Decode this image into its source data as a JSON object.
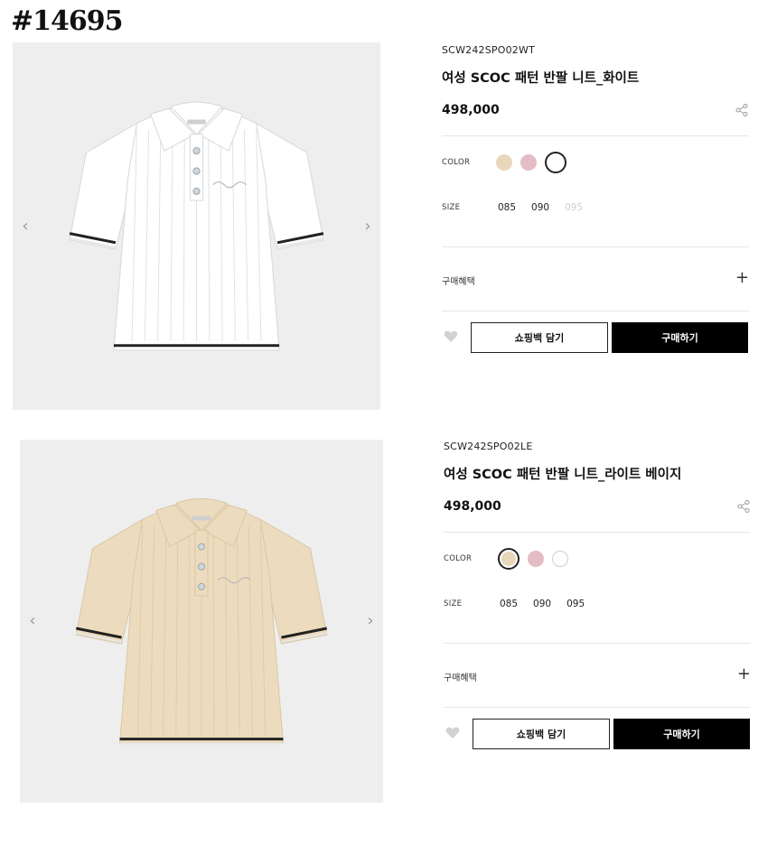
{
  "page_tag": "#14695",
  "products": [
    {
      "code": "SCW242SPO02WT",
      "name": "여성 SCOC 패턴 반팔 니트_화이트",
      "price": "498,000",
      "color_label": "COLOR",
      "colors": [
        {
          "name": "light-beige",
          "hex": "#e8d7bb",
          "selected": false
        },
        {
          "name": "pink",
          "hex": "#e3bcc5",
          "selected": false
        },
        {
          "name": "white",
          "hex": "#ffffff",
          "selected": true
        }
      ],
      "size_label": "SIZE",
      "sizes": [
        {
          "label": "085",
          "available": true
        },
        {
          "label": "090",
          "available": true
        },
        {
          "label": "095",
          "available": false
        }
      ],
      "benefit_label": "구매혜택",
      "cart_label": "쇼핑백 담기",
      "buy_label": "구매하기",
      "shirt_color": "#ffffff"
    },
    {
      "code": "SCW242SPO02LE",
      "name": "여성 SCOC 패턴 반팔 니트_라이트 베이지",
      "price": "498,000",
      "color_label": "COLOR",
      "colors": [
        {
          "name": "light-beige",
          "hex": "#e8d7bb",
          "selected": true
        },
        {
          "name": "pink",
          "hex": "#e3bcc5",
          "selected": false
        },
        {
          "name": "white",
          "hex": "#ffffff",
          "selected": false
        }
      ],
      "size_label": "SIZE",
      "sizes": [
        {
          "label": "085",
          "available": true
        },
        {
          "label": "090",
          "available": true
        },
        {
          "label": "095",
          "available": true
        }
      ],
      "benefit_label": "구매혜택",
      "cart_label": "쇼핑백 담기",
      "buy_label": "구매하기",
      "shirt_color": "#ecdcbd"
    }
  ]
}
